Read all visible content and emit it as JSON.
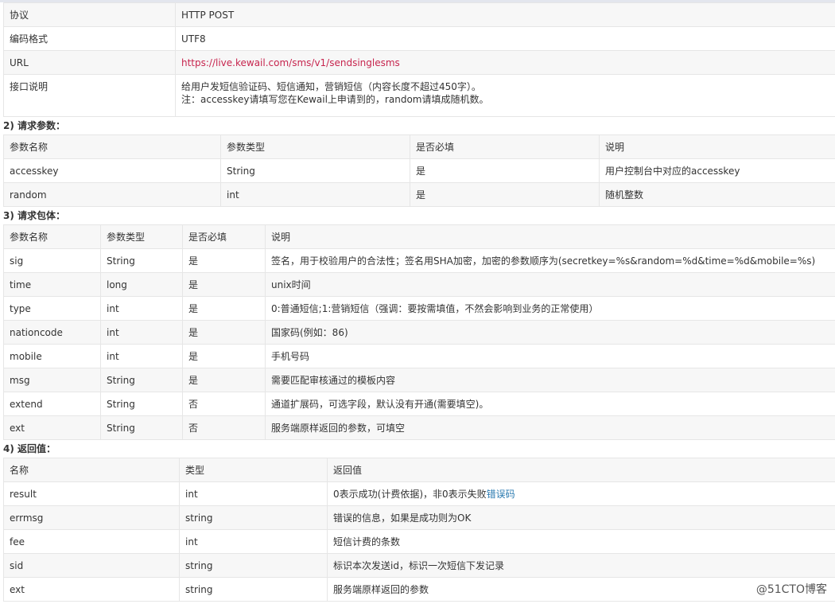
{
  "info_table": [
    {
      "label": "协议",
      "value": "HTTP POST"
    },
    {
      "label": "编码格式",
      "value": "UTF8"
    },
    {
      "label": "URL",
      "value": "https://live.kewail.com/sms/v1/sendsinglesms"
    },
    {
      "label": "接口说明",
      "line1": "给用户发短信验证码、短信通知，营销短信（内容长度不超过450字）。",
      "line2": "注：accesskey请填写您在Kewail上申请到的，random请填成随机数。"
    }
  ],
  "section2": {
    "title": "2) 请求参数：",
    "headers": [
      "参数名称",
      "参数类型",
      "是否必填",
      "说明"
    ],
    "rows": [
      [
        "accesskey",
        "String",
        "是",
        "用户控制台中对应的accesskey"
      ],
      [
        "random",
        "int",
        "是",
        "随机整数"
      ]
    ]
  },
  "section3": {
    "title": "3) 请求包体：",
    "headers": [
      "参数名称",
      "参数类型",
      "是否必填",
      "说明"
    ],
    "rows": [
      [
        "sig",
        "String",
        "是",
        "签名，用于校验用户的合法性；签名用SHA加密，加密的参数顺序为(secretkey=%s&random=%d&time=%d&mobile=%s)"
      ],
      [
        "time",
        "long",
        "是",
        "unix时间"
      ],
      [
        "type",
        "int",
        "是",
        "0:普通短信;1:营销短信（强调：要按需填值，不然会影响到业务的正常使用）"
      ],
      [
        "nationcode",
        "int",
        "是",
        "国家码(例如：86)"
      ],
      [
        "mobile",
        "int",
        "是",
        "手机号码"
      ],
      [
        "msg",
        "String",
        "是",
        "需要匹配审核通过的模板内容"
      ],
      [
        "extend",
        "String",
        "否",
        "通道扩展码，可选字段，默认没有开通(需要填空)。"
      ],
      [
        "ext",
        "String",
        "否",
        "服务端原样返回的参数，可填空"
      ]
    ]
  },
  "section4": {
    "title": "4) 返回值：",
    "headers": [
      "名称",
      "类型",
      "返回值"
    ],
    "rows": [
      [
        "result",
        "int",
        "0表示成功(计费依据)，非0表示失败"
      ],
      [
        "errmsg",
        "string",
        "错误的信息，如果是成功则为OK"
      ],
      [
        "fee",
        "int",
        "短信计费的条数"
      ],
      [
        "sid",
        "string",
        "标识本次发送id，标识一次短信下发记录"
      ],
      [
        "ext",
        "string",
        "服务端原样返回的参数"
      ]
    ],
    "error_link_text": "错误码"
  },
  "watermark": "@51CTO博客"
}
